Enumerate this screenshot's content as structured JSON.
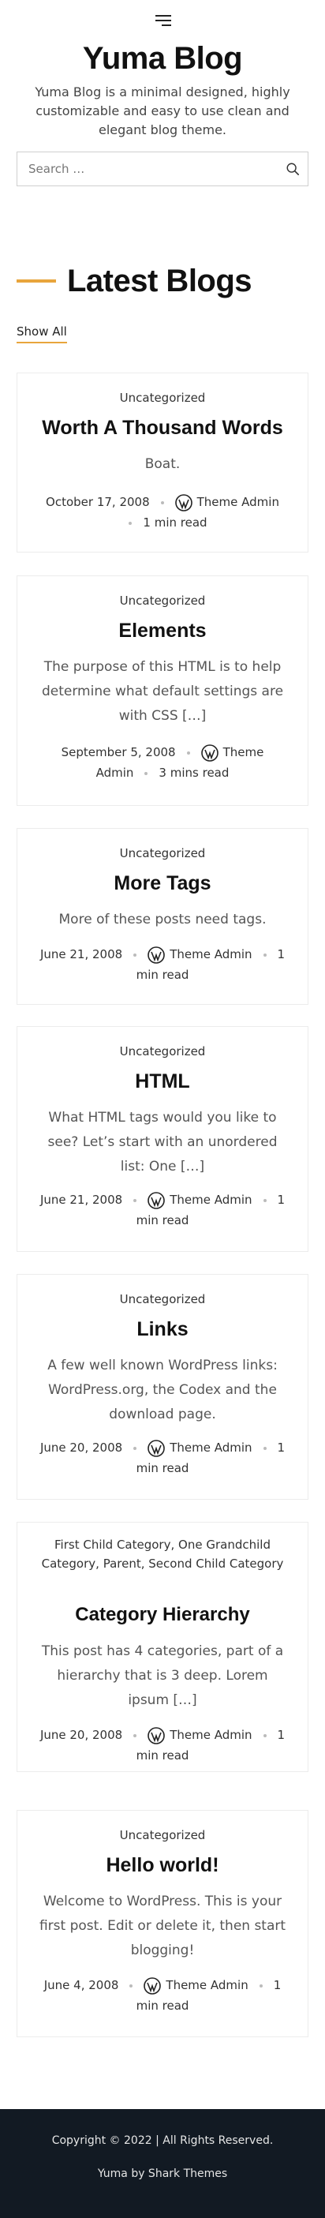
{
  "site": {
    "title": "Yuma Blog",
    "description": "Yuma Blog is a minimal designed, highly customizable and easy to use clean and elegant blog theme."
  },
  "search": {
    "placeholder": "Search …"
  },
  "section": {
    "title": "Latest Blogs",
    "show_all": "Show All"
  },
  "icons": {
    "menu": "hamburger-menu-icon",
    "search": "search-icon",
    "author": "wordpress-avatar-icon"
  },
  "posts": [
    {
      "category": "Uncategorized",
      "title": "Worth A Thousand Words",
      "excerpt": "Boat.",
      "date": "October 17, 2008",
      "author": "Theme Admin",
      "read_time": "1 min read"
    },
    {
      "category": "Uncategorized",
      "title": "Elements",
      "excerpt": "The purpose of this HTML is to help determine what default settings are with CSS […]",
      "date": "September 5, 2008",
      "author": "Theme Admin",
      "read_time": "3 mins read"
    },
    {
      "category": "Uncategorized",
      "title": "More Tags",
      "excerpt": "More of these posts need tags.",
      "date": "June 21, 2008",
      "author": "Theme Admin",
      "read_time": "1 min read"
    },
    {
      "category": "Uncategorized",
      "title": "HTML",
      "excerpt": "What HTML tags would you like to see? Let’s start with an unordered list: One […]",
      "date": "June 21, 2008",
      "author": "Theme Admin",
      "read_time": "1 min read"
    },
    {
      "category": "Uncategorized",
      "title": "Links",
      "excerpt": "A few well known WordPress links: WordPress.org, the Codex and the download page.",
      "date": "June 20, 2008",
      "author": "Theme Admin",
      "read_time": "1 min read"
    },
    {
      "categories": [
        "First Child Category",
        "One Grandchild Category",
        "Parent",
        "Second Child Category"
      ],
      "title": "Category Hierarchy",
      "excerpt": "This post has 4 categories, part of a hierarchy that is 3 deep. Lorem ipsum […]",
      "date": "June 20, 2008",
      "author": "Theme Admin",
      "read_time": "1 min read"
    },
    {
      "category": "Uncategorized",
      "title": "Hello world!",
      "excerpt": "Welcome to WordPress. This is your first post. Edit or delete it, then start blogging!",
      "date": "June 4, 2008",
      "author": "Theme Admin",
      "read_time": "1 min read"
    }
  ],
  "footer": {
    "copyright": "Copyright © 2022 | All Rights Reserved.",
    "credit": "Yuma by Shark Themes"
  },
  "colors": {
    "accent": "#e8a53c",
    "footer_bg": "#121a23"
  }
}
